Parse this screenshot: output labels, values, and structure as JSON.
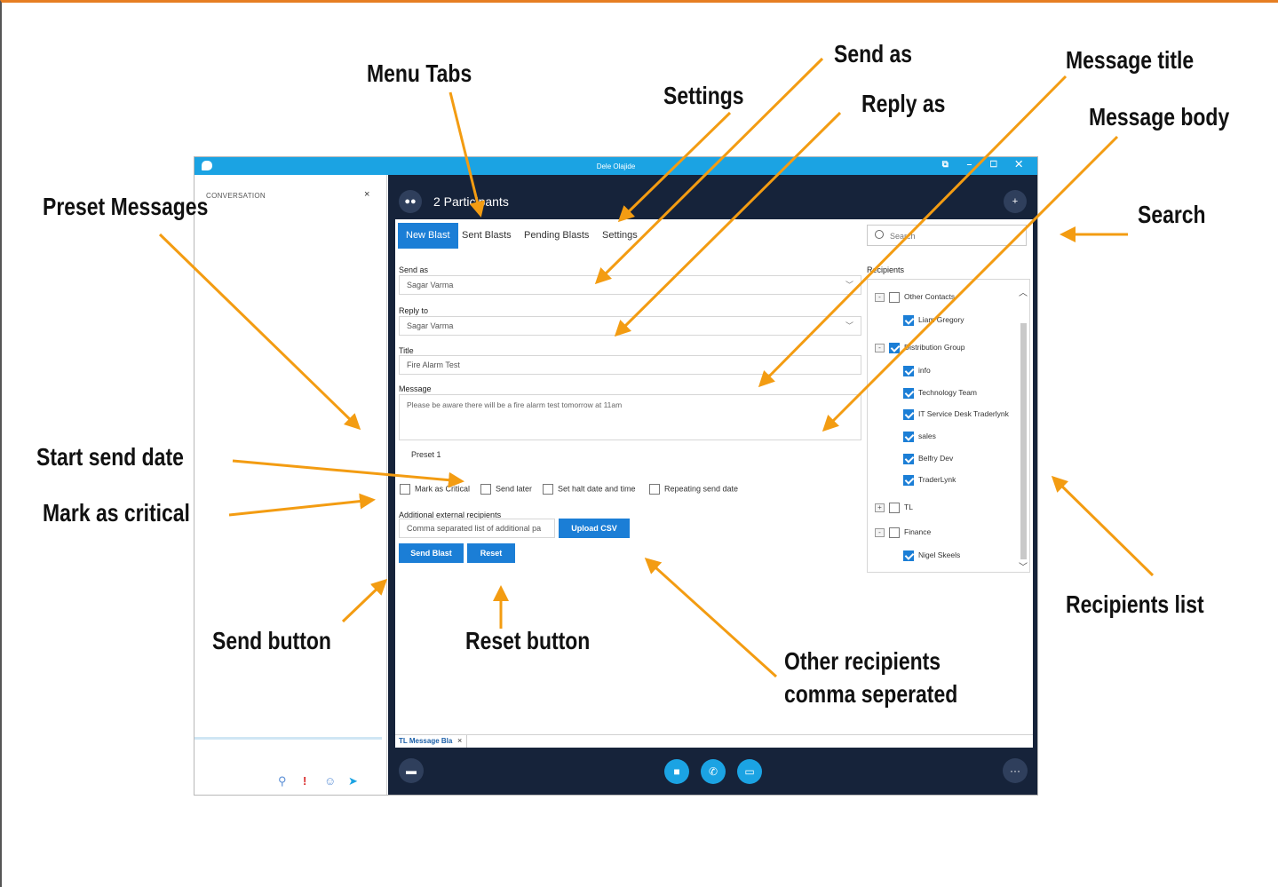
{
  "window": {
    "title": "Dele Olajide",
    "controls": "⧉ – ☐ ✕"
  },
  "conversation": {
    "label": "CONVERSATION",
    "close": "×"
  },
  "header": {
    "participants": "2 Participants"
  },
  "tabs": [
    "New Blast",
    "Sent Blasts",
    "Pending Blasts",
    "Settings"
  ],
  "search": {
    "placeholder": "Search"
  },
  "form": {
    "send_as_label": "Send as",
    "send_as_value": "Sagar Varma",
    "reply_to_label": "Reply to",
    "reply_to_value": "Sagar Varma",
    "title_label": "Title",
    "title_value": "Fire Alarm Test",
    "message_label": "Message",
    "message_value": "Please be aware there will be a fire alarm test tomorrow at 11am",
    "preset": "Preset 1",
    "options": [
      "Mark as Critical",
      "Send later",
      "Set halt date and time",
      "Repeating send date"
    ],
    "external_label": "Additional external recipients",
    "external_placeholder": "Comma separated list of additional pa",
    "upload_csv": "Upload CSV",
    "send_blast": "Send Blast",
    "reset": "Reset"
  },
  "recipients": {
    "label": "Recipients",
    "items": [
      {
        "label": "Other Contacts",
        "level": 0,
        "expander": "-",
        "checked": false
      },
      {
        "label": "Liam Gregory",
        "level": 1,
        "checked": true
      },
      {
        "label": "Distribution Group",
        "level": 0,
        "expander": "-",
        "checked": true
      },
      {
        "label": "info",
        "level": 1,
        "checked": true
      },
      {
        "label": "Technology Team",
        "level": 1,
        "checked": true
      },
      {
        "label": "IT Service Desk Traderlynk",
        "level": 1,
        "checked": true
      },
      {
        "label": "sales",
        "level": 1,
        "checked": true
      },
      {
        "label": "Belfry Dev",
        "level": 1,
        "checked": true
      },
      {
        "label": "TraderLynk",
        "level": 1,
        "checked": true
      },
      {
        "label": "TL",
        "level": 0,
        "expander": "+",
        "checked": false
      },
      {
        "label": "Finance",
        "level": 0,
        "expander": "-",
        "checked": false
      },
      {
        "label": "Nigel Skeels",
        "level": 1,
        "checked": true
      }
    ]
  },
  "bottom_tab": {
    "label": "TL Message Bla",
    "close": "×"
  },
  "annotations": {
    "menu_tabs": "Menu Tabs",
    "settings": "Settings",
    "send_as": "Send as",
    "reply_as": "Reply as",
    "message_title": "Message title",
    "message_body": "Message body",
    "preset_messages": "Preset Messages",
    "search": "Search",
    "start_send_date": "Start send date",
    "mark_as_critical": "Mark as critical",
    "send_button": "Send button",
    "reset_button": "Reset button",
    "other_recipients_1": "Other recipients",
    "other_recipients_2": "comma seperated",
    "recipients_list": "Recipients list"
  },
  "colors": {
    "accent": "#1b7ed6",
    "titlebar": "#1ba3e3",
    "dark_panel": "#16233a",
    "arrow": "#f39c12"
  }
}
